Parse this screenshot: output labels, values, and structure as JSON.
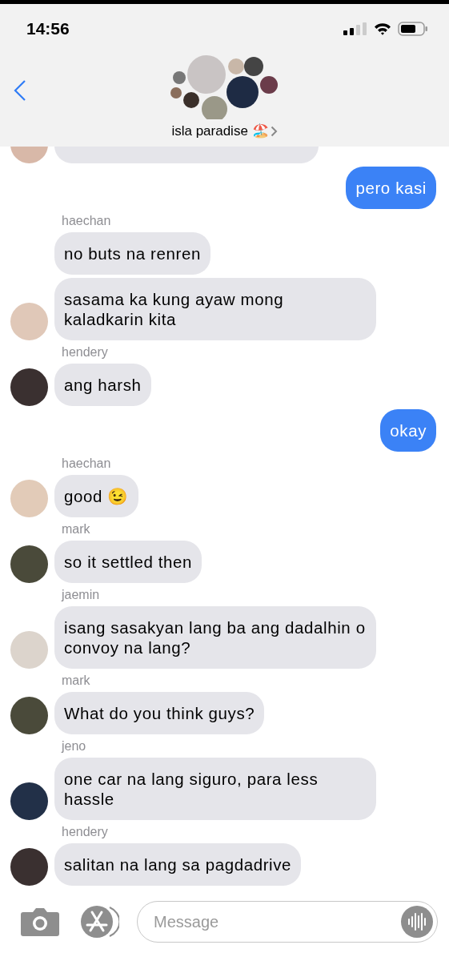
{
  "status_bar": {
    "time": "14:56"
  },
  "header": {
    "title": "isla paradise 🏖️"
  },
  "groups": [
    {
      "kind": "clipped"
    },
    {
      "kind": "outgoing",
      "bubbles": [
        "pero kasi"
      ]
    },
    {
      "kind": "incoming",
      "sender": "haechan",
      "bubbles": [
        "no buts na renren",
        "sasama ka kung ayaw mong kaladkarin kita"
      ]
    },
    {
      "kind": "incoming",
      "sender": "hendery",
      "bubbles": [
        "ang harsh"
      ]
    },
    {
      "kind": "outgoing",
      "bubbles": [
        "okay"
      ]
    },
    {
      "kind": "incoming",
      "sender": "haechan",
      "bubbles": [
        "good 😉"
      ]
    },
    {
      "kind": "incoming",
      "sender": "mark",
      "bubbles": [
        "so it settled then"
      ]
    },
    {
      "kind": "incoming",
      "sender": "jaemin",
      "bubbles": [
        "isang sasakyan lang ba ang dadalhin o convoy na lang?"
      ]
    },
    {
      "kind": "incoming",
      "sender": "mark",
      "bubbles": [
        "What do you think guys?"
      ]
    },
    {
      "kind": "incoming",
      "sender": "jeno",
      "bubbles": [
        "one car na lang siguro, para less hassle"
      ]
    },
    {
      "kind": "incoming",
      "sender": "hendery",
      "bubbles": [
        "salitan na lang sa pagdadrive"
      ]
    }
  ],
  "composer": {
    "placeholder": "Message"
  }
}
